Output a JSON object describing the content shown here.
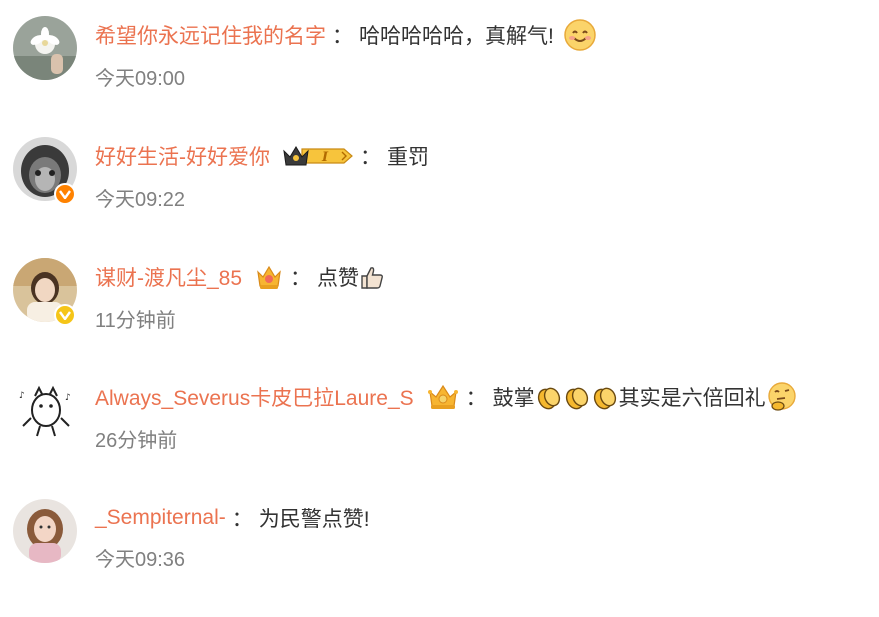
{
  "separator": "：",
  "comments": [
    {
      "username": "希望你永远记住我的名字",
      "content": "哈哈哈哈哈，真解气!",
      "time": "今天09:00",
      "verified": false,
      "badge": null,
      "emoji": "smile-emoji"
    },
    {
      "username": "好好生活-好好爱你",
      "content": "重罚",
      "time": "今天09:22",
      "verified": true,
      "verify_color": "#ff8200",
      "badge": "vip-crown-badge",
      "badge_text": "I"
    },
    {
      "username": "谋财-渡凡尘_85",
      "content": "点赞",
      "time": "11分钟前",
      "verified": true,
      "verify_color": "#f5c518",
      "badge": "crown-badge",
      "emoji": "thumbs-up-emoji"
    },
    {
      "username": "Always_Severus卡皮巴拉Laure_S",
      "content_part1": "鼓掌",
      "content_part2": "其实是六倍回礼",
      "time": "26分钟前",
      "verified": false,
      "badge": "crown-badge",
      "emoji": "clap-emoji x3, thinking-emoji"
    },
    {
      "username": "_Sempiternal-",
      "content": "为民警点赞!",
      "time": "今天09:36",
      "verified": false,
      "badge": null
    }
  ],
  "colors": {
    "username": "#eb7350",
    "content": "#333333",
    "timestamp": "#808080"
  }
}
